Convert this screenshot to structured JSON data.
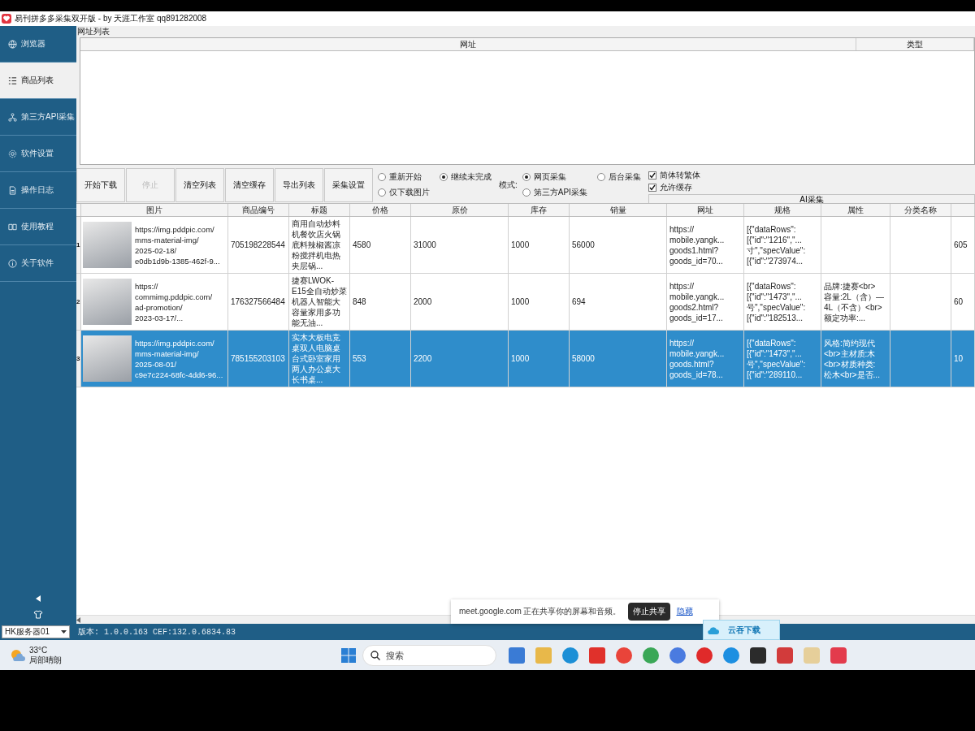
{
  "window": {
    "title": "易刊拼多多采集双开版 - by 天涯工作室 qq891282008"
  },
  "sidebar": {
    "items": [
      {
        "label": "浏览器",
        "selected": false
      },
      {
        "label": "商品列表",
        "selected": true
      },
      {
        "label": "第三方API采集",
        "selected": false
      },
      {
        "label": "软件设置",
        "selected": false
      },
      {
        "label": "操作日志",
        "selected": false
      },
      {
        "label": "使用教程",
        "selected": false
      },
      {
        "label": "关于软件",
        "selected": false
      }
    ]
  },
  "url_list": {
    "label": "网址列表",
    "columns": [
      "网址",
      "类型"
    ]
  },
  "toolbar": {
    "buttons": [
      {
        "label": "开始下载",
        "disabled": false
      },
      {
        "label": "停止",
        "disabled": true
      },
      {
        "label": "清空列表",
        "disabled": false
      },
      {
        "label": "清空缓存",
        "disabled": false
      },
      {
        "label": "导出列表",
        "disabled": false
      },
      {
        "label": "采集设置",
        "disabled": false
      }
    ],
    "start_options": [
      {
        "label": "重新开始",
        "selected": false
      },
      {
        "label": "继续未完成",
        "selected": true
      },
      {
        "label": "仅下载图片",
        "selected": false
      }
    ],
    "mode": {
      "label": "模式:",
      "options": [
        {
          "label": "网页采集",
          "selected": true
        },
        {
          "label": "后台采集",
          "selected": false
        },
        {
          "label": "第三方API采集",
          "selected": false
        }
      ]
    },
    "checkboxes": [
      {
        "label": "简体转繁体",
        "checked": true
      },
      {
        "label": "允许缓存",
        "checked": true
      }
    ],
    "ai_button": "AI采集"
  },
  "products": {
    "columns": [
      "图片",
      "商品编号",
      "标题",
      "价格",
      "原价",
      "库存",
      "销量",
      "网址",
      "规格",
      "属性",
      "分类名称"
    ],
    "rows": [
      {
        "index": "1",
        "selected": false,
        "image_url": "https://img.pddpic.com/\nmms-material-img/\n2025-02-18/\ne0db1d9b-1385-462f-9...",
        "product_id": "705198228544",
        "title": "商用自动炒料机餐饮店火锅底料辣椒酱凉粉搅拌机电热夹层锅...",
        "price": "4580",
        "original_price": "31000",
        "stock": "1000",
        "sales": "56000",
        "url": "https://\nmobile.yangk...\ngoods1.html?\ngoods_id=70...",
        "spec": "[{\"dataRows\":\n[{\"id\":\"1216\",\"...\n寸\",\"specValue\":\n[{\"id\":\"273974...",
        "column_13": "605"
      },
      {
        "index": "2",
        "selected": false,
        "image_url": "https://\ncommimg.pddpic.com/\nad-promotion/\n2023-03-17/...",
        "product_id": "176327566484",
        "title": "捷赛LWOK-E15全自动炒菜机器人智能大容量家用多功能无油...",
        "price": "848",
        "original_price": "2000",
        "stock": "1000",
        "sales": "694",
        "url": "https://\nmobile.yangk...\ngoods2.html?\ngoods_id=17...",
        "spec": "[{\"dataRows\":\n[{\"id\":\"1473\",\"...\n号\",\"specValue\":\n[{\"id\":\"182513...",
        "attributes": "品牌:捷赛<br>\n容量:2L（含）—\n4L（不含）<br>\n额定功率:...",
        "column_13": "60"
      },
      {
        "index": "3",
        "selected": true,
        "image_url": "https://img.pddpic.com/\nmms-material-img/\n2025-08-01/\nc9e7c224-68fc-4dd6-96...",
        "product_id": "785155203103",
        "title": "实木大板电竞桌双人电脑桌台式卧室家用两人办公桌大长书桌...",
        "price": "553",
        "original_price": "2200",
        "stock": "1000",
        "sales": "58000",
        "url": "https://\nmobile.yangk...\ngoods.html?\ngoods_id=78...",
        "spec": "[{\"dataRows\":\n[{\"id\":\"1473\",\"...\n号\",\"specValue\":\n[{\"id\":\"289110...",
        "attributes": "风格:简约现代\n<br>主材质:木\n<br>材质种类:\n松木<br>是否...",
        "column_13": "10"
      }
    ]
  },
  "status_bar": {
    "server": "HK服务器01",
    "version": "版本: 1.0.0.163 CEF:132.0.6834.83"
  },
  "share_banner": {
    "message": "meet.google.com 正在共享你的屏幕和音频。",
    "stop_button": "停止共享",
    "hide_link": "隐藏"
  },
  "download_widget": {
    "label": "云吞下载"
  },
  "taskbar": {
    "weather": {
      "temperature": "33°C",
      "condition": "局部晴朗"
    },
    "search": {
      "placeholder": "搜索"
    }
  }
}
